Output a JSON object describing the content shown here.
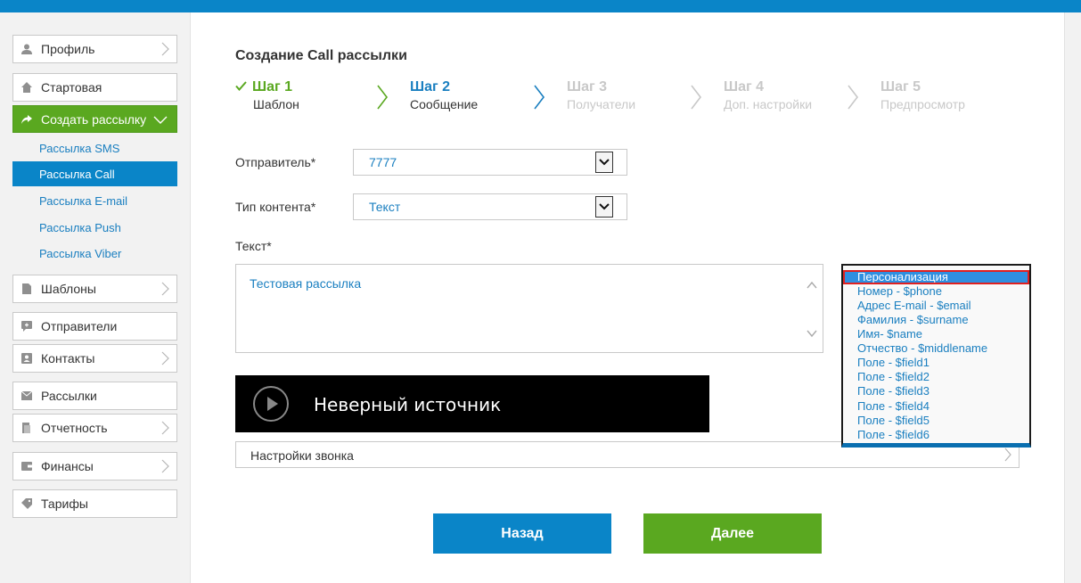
{
  "sidebar": {
    "items": [
      {
        "label": "Профиль",
        "icon": "user-icon"
      },
      {
        "label": "Стартовая",
        "icon": "home-icon"
      },
      {
        "label": "Создать рассылку",
        "icon": "share-icon"
      },
      {
        "label": "Шаблоны",
        "icon": "document-icon"
      },
      {
        "label": "Отправители",
        "icon": "sender-icon"
      },
      {
        "label": "Контакты",
        "icon": "contacts-icon"
      },
      {
        "label": "Рассылки",
        "icon": "mail-icon"
      },
      {
        "label": "Отчетность",
        "icon": "report-icon"
      },
      {
        "label": "Финансы",
        "icon": "wallet-icon"
      },
      {
        "label": "Тарифы",
        "icon": "tag-icon"
      }
    ],
    "submenu": [
      "Рассылка SMS",
      "Рассылка Call",
      "Рассылка E-mail",
      "Рассылка Push",
      "Рассылка Viber"
    ]
  },
  "page": {
    "title": "Создание Call рассылки"
  },
  "steps": [
    {
      "title": "Шаг 1",
      "subtitle": "Шаблон",
      "state": "done"
    },
    {
      "title": "Шаг 2",
      "subtitle": "Сообщение",
      "state": "current"
    },
    {
      "title": "Шаг 3",
      "subtitle": "Получатели",
      "state": "pending"
    },
    {
      "title": "Шаг 4",
      "subtitle": "Доп. настройки",
      "state": "pending"
    },
    {
      "title": "Шаг 5",
      "subtitle": "Предпросмотр",
      "state": "pending"
    }
  ],
  "form": {
    "sender_label": "Отправитель*",
    "sender_value": "7777",
    "content_type_label": "Тип контента*",
    "content_type_value": "Текст",
    "text_label": "Текст*",
    "text_value": "Тестовая рассылка"
  },
  "player": {
    "message": "Неверный источник"
  },
  "call_settings": {
    "label": "Настройки звонка"
  },
  "personalization": {
    "options": [
      "Персонализация",
      "Номер - $phone",
      "Адрес E-mail - $email",
      "Фамилия - $surname",
      "Имя- $name",
      "Отчество - $middlename",
      "Поле - $field1",
      "Поле - $field2",
      "Поле - $field3",
      "Поле - $field4",
      "Поле - $field5",
      "Поле - $field6"
    ]
  },
  "buttons": {
    "back": "Назад",
    "next": "Далее"
  },
  "colors": {
    "brand_blue": "#0a85c8",
    "brand_green": "#5aa820",
    "link_blue": "#1a7fc0"
  }
}
